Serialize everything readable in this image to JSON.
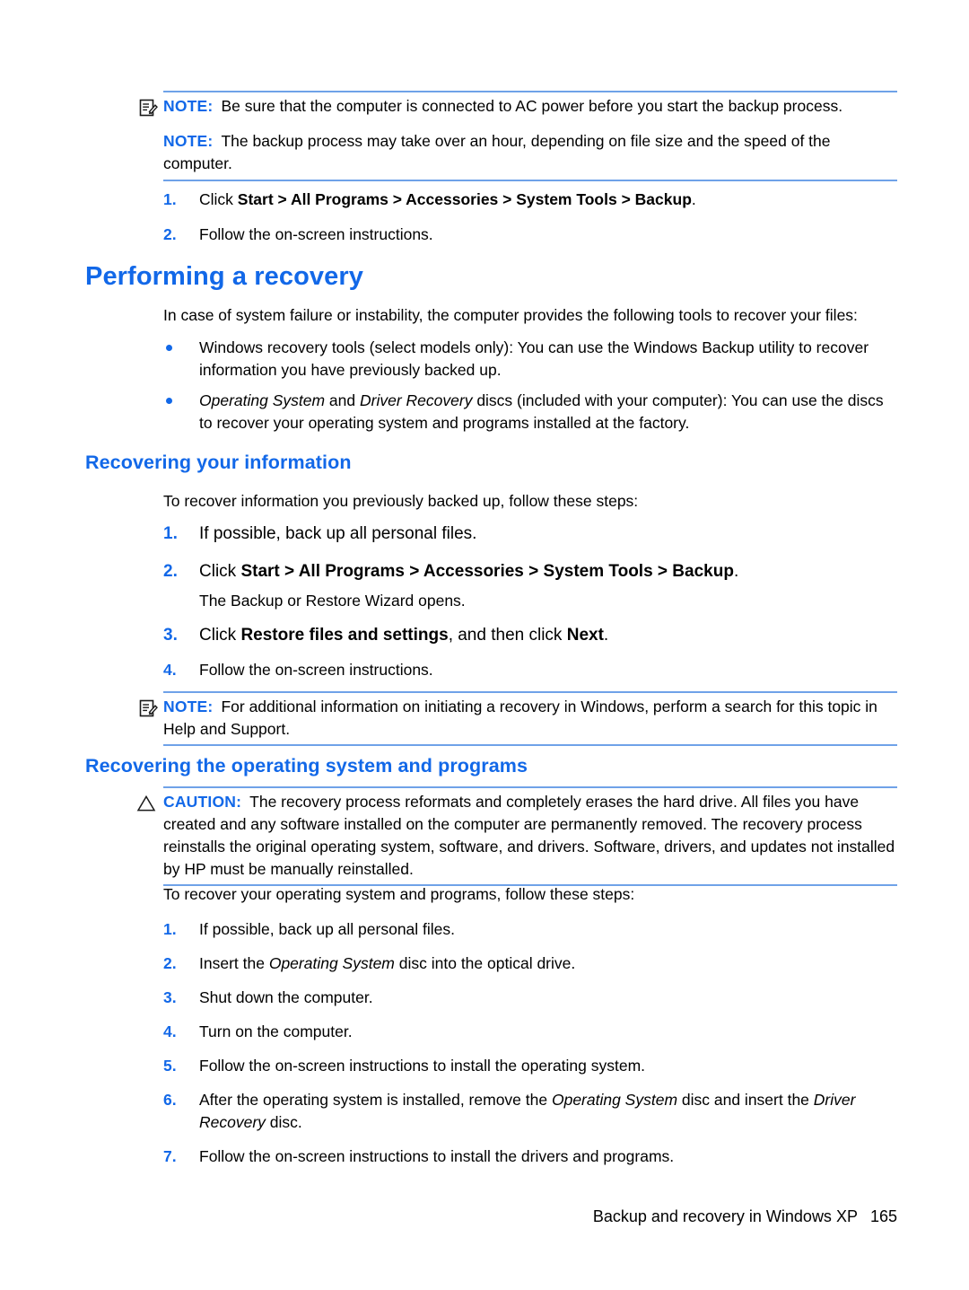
{
  "document": {
    "page_number": "165",
    "footer_text": "Backup and recovery in Windows XP",
    "accent_color": "#1268e8",
    "rule_color": "#6fa2e8"
  },
  "note_box_top": {
    "icon": "note-icon",
    "notes": [
      {
        "label": "NOTE:",
        "text": "Be sure that the computer is connected to AC power before you start the backup process."
      },
      {
        "label": "NOTE:",
        "text": "The backup process may take over an hour, depending on file size and the speed of the computer."
      }
    ]
  },
  "backup_steps": {
    "items": [
      {
        "marker": "1.",
        "prefix": "Click ",
        "bold": "Start > All Programs > Accessories > System Tools > Backup",
        "suffix": "."
      },
      {
        "marker": "2.",
        "prefix": "Follow the on-screen instructions.",
        "bold": "",
        "suffix": ""
      }
    ]
  },
  "section_performing_recovery": {
    "heading": "Performing a recovery",
    "intro": "In case of system failure or instability, the computer provides the following tools to recover your files:",
    "bullets": [
      {
        "italic_lead": "",
        "text": "Windows recovery tools (select models only): You can use the Windows Backup utility to recover information you have previously backed up."
      },
      {
        "italic_a": "Operating System",
        "mid": " and ",
        "italic_b": "Driver Recovery",
        "text": " discs (included with your computer): You can use the discs to recover your operating system and programs installed at the factory."
      }
    ]
  },
  "section_recovering_information": {
    "heading": "Recovering your information",
    "intro": "To recover information you previously backed up, follow these steps:",
    "steps": [
      {
        "marker": "1.",
        "prefix": "If possible, back up all personal files.",
        "bold": "",
        "suffix": ""
      },
      {
        "marker": "2.",
        "prefix": "Click ",
        "bold": "Start > All Programs > Accessories > System Tools > Backup",
        "suffix": "."
      }
    ],
    "after_step2": "The Backup or Restore Wizard opens.",
    "steps_cont": [
      {
        "marker": "3.",
        "prefix": "Click ",
        "bold": "Restore files and settings",
        "mid": ", and then click ",
        "bold2": "Next",
        "suffix": "."
      },
      {
        "marker": "4.",
        "prefix": "Follow the on-screen instructions.",
        "bold": "",
        "suffix": ""
      }
    ],
    "note": {
      "icon": "note-icon",
      "label": "NOTE:",
      "text": "For additional information on initiating a recovery in Windows, perform a search for this topic in Help and Support."
    }
  },
  "section_recovering_os": {
    "heading": "Recovering the operating system and programs",
    "caution": {
      "icon": "caution-triangle-icon",
      "label": "CAUTION:",
      "text": "The recovery process reformats and completely erases the hard drive. All files you have created and any software installed on the computer are permanently removed. The recovery process reinstalls the original operating system, software, and drivers. Software, drivers, and updates not installed by HP must be manually reinstalled."
    },
    "intro": "To recover your operating system and programs, follow these steps:",
    "steps": [
      {
        "marker": "1.",
        "pre": "If possible, back up all personal files.",
        "italic": "",
        "post": ""
      },
      {
        "marker": "2.",
        "pre": "Insert the ",
        "italic": "Operating System",
        "post": " disc into the optical drive."
      },
      {
        "marker": "3.",
        "pre": "Shut down the computer.",
        "italic": "",
        "post": ""
      },
      {
        "marker": "4.",
        "pre": "Turn on the computer.",
        "italic": "",
        "post": ""
      },
      {
        "marker": "5.",
        "pre": "Follow the on-screen instructions to install the operating system.",
        "italic": "",
        "post": ""
      },
      {
        "marker": "6.",
        "pre": "After the operating system is installed, remove the ",
        "italic": "Operating System",
        "post": " disc and insert the ",
        "italic2": "Driver Recovery",
        "post2": " disc."
      },
      {
        "marker": "7.",
        "pre": "Follow the on-screen instructions to install the drivers and programs.",
        "italic": "",
        "post": ""
      }
    ]
  }
}
